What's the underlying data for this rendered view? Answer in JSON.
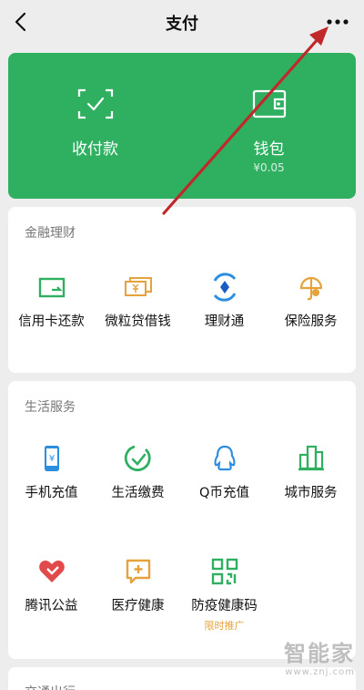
{
  "navbar": {
    "title": "支付"
  },
  "wallet": {
    "pay": {
      "label": "收付款"
    },
    "balance": {
      "label": "钱包",
      "amount": "¥0.05"
    }
  },
  "finance": {
    "title": "金融理财",
    "items": [
      {
        "label": "信用卡还款",
        "icon": "credit-card-icon"
      },
      {
        "label": "微粒贷借钱",
        "icon": "loan-icon"
      },
      {
        "label": "理财通",
        "icon": "wealth-icon"
      },
      {
        "label": "保险服务",
        "icon": "umbrella-icon"
      }
    ]
  },
  "life": {
    "title": "生活服务",
    "items": [
      {
        "label": "手机充值",
        "icon": "phone-icon"
      },
      {
        "label": "生活缴费",
        "icon": "bill-icon"
      },
      {
        "label": "Q币充值",
        "icon": "qq-icon"
      },
      {
        "label": "城市服务",
        "icon": "city-icon"
      },
      {
        "label": "腾讯公益",
        "icon": "heart-icon"
      },
      {
        "label": "医疗健康",
        "icon": "medical-icon"
      },
      {
        "label": "防疫健康码",
        "icon": "qrcode-icon",
        "tag": "限时推广"
      }
    ]
  },
  "transport": {
    "title": "交通出行"
  },
  "watermark": {
    "text": "智能家",
    "url": "www.znj.com"
  },
  "colors": {
    "brand_green": "#2fb061",
    "accent_orange": "#e6a23c",
    "annotation_red": "#c0282a"
  }
}
